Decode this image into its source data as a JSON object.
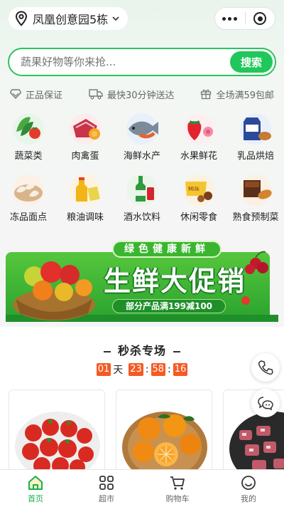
{
  "header": {
    "location": "凤凰创意园5栋",
    "location_icon": "location-pin-icon",
    "more_icon": "more-dots-icon",
    "close_icon": "target-circle-icon"
  },
  "search": {
    "placeholder": "蔬果好物等你来抢...",
    "button_label": "搜索"
  },
  "guarantees": [
    {
      "icon": "diamond-shield-icon",
      "text": "正品保证"
    },
    {
      "icon": "truck-icon",
      "text": "最快30分钟送达"
    },
    {
      "icon": "gift-icon",
      "text": "全场满59包邮"
    }
  ],
  "categories": [
    {
      "label": "蔬菜类",
      "icon": "vegetables-icon"
    },
    {
      "label": "肉禽蛋",
      "icon": "meat-egg-icon"
    },
    {
      "label": "海鲜水产",
      "icon": "seafood-icon"
    },
    {
      "label": "水果鲜花",
      "icon": "fruit-flower-icon"
    },
    {
      "label": "乳品烘焙",
      "icon": "dairy-bakery-icon"
    },
    {
      "label": "冻品面点",
      "icon": "frozen-dumpling-icon"
    },
    {
      "label": "粮油调味",
      "icon": "grain-oil-icon"
    },
    {
      "label": "酒水饮料",
      "icon": "drinks-icon"
    },
    {
      "label": "休闲零食",
      "icon": "snacks-icon"
    },
    {
      "label": "熟食预制菜",
      "icon": "deli-food-icon"
    }
  ],
  "banner": {
    "tagline": "绿色健康新鲜",
    "headline": "生鲜大促销",
    "subline": "部分产品满199减100"
  },
  "seckill": {
    "title": "秒杀专场",
    "timer": {
      "days": "01",
      "day_unit": "天",
      "hours": "23",
      "minutes": "58",
      "seconds": "16",
      "sep": ":"
    },
    "products": [
      {
        "name": "tomatoes"
      },
      {
        "name": "oranges"
      },
      {
        "name": "pork-ribs"
      }
    ]
  },
  "floating": {
    "phone_icon": "phone-icon",
    "chat_icon": "chat-bubble-icon"
  },
  "tabbar": {
    "active": 0,
    "tabs": [
      {
        "label": "首页",
        "icon": "home-icon"
      },
      {
        "label": "超市",
        "icon": "grid-icon"
      },
      {
        "label": "购物车",
        "icon": "cart-icon"
      },
      {
        "label": "我的",
        "icon": "smiley-user-icon"
      }
    ]
  },
  "colors": {
    "accent": "#21c75a",
    "accent_border": "#2bc45d",
    "timer": "#f55a22",
    "tab_active": "#18b04f"
  }
}
